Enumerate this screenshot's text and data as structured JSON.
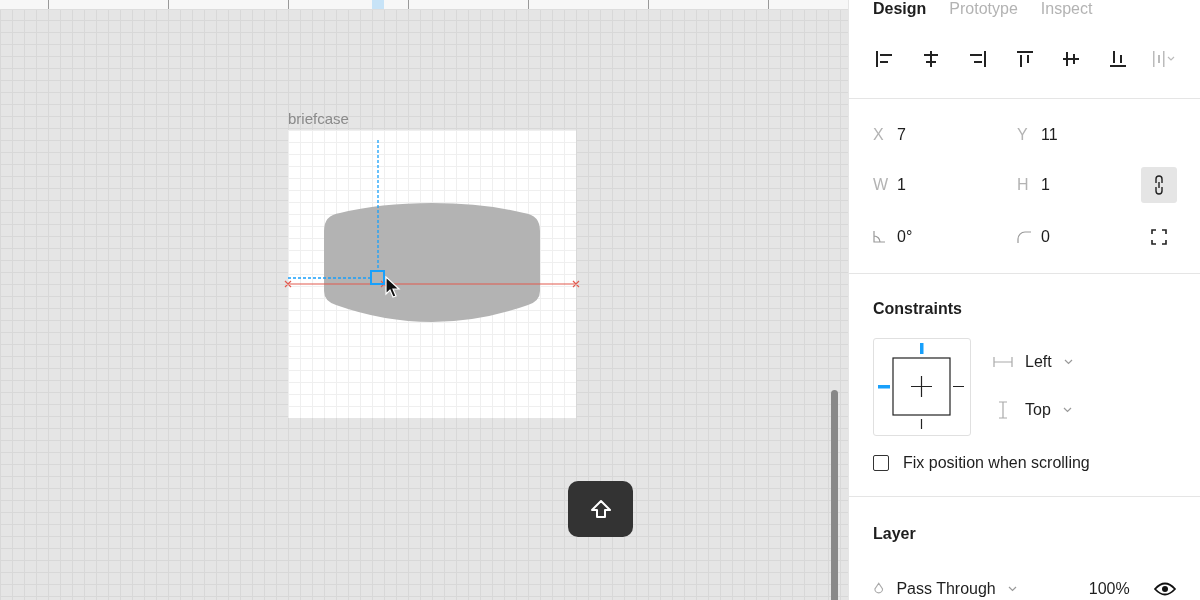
{
  "canvas": {
    "frame_label": "briefcase"
  },
  "tabs": [
    {
      "label": "Design",
      "selected": true
    },
    {
      "label": "Prototype",
      "selected": false
    },
    {
      "label": "Inspect",
      "selected": false
    }
  ],
  "geometry": [
    {
      "label": "X",
      "value": "7"
    },
    {
      "label": "Y",
      "value": "11"
    },
    {
      "label": "W",
      "value": "1"
    },
    {
      "label": "H",
      "value": "1"
    }
  ],
  "constrain_proportions": {
    "on": true
  },
  "rotation": "0°",
  "corner_radius": "0",
  "constraints": {
    "title": "Constraints",
    "horizontal": "Left",
    "vertical": "Top",
    "fix_position": {
      "label": "Fix position when scrolling",
      "checked": false
    }
  },
  "layer": {
    "title": "Layer",
    "blend_mode": "Pass Through",
    "opacity": "100%",
    "visible": true
  }
}
